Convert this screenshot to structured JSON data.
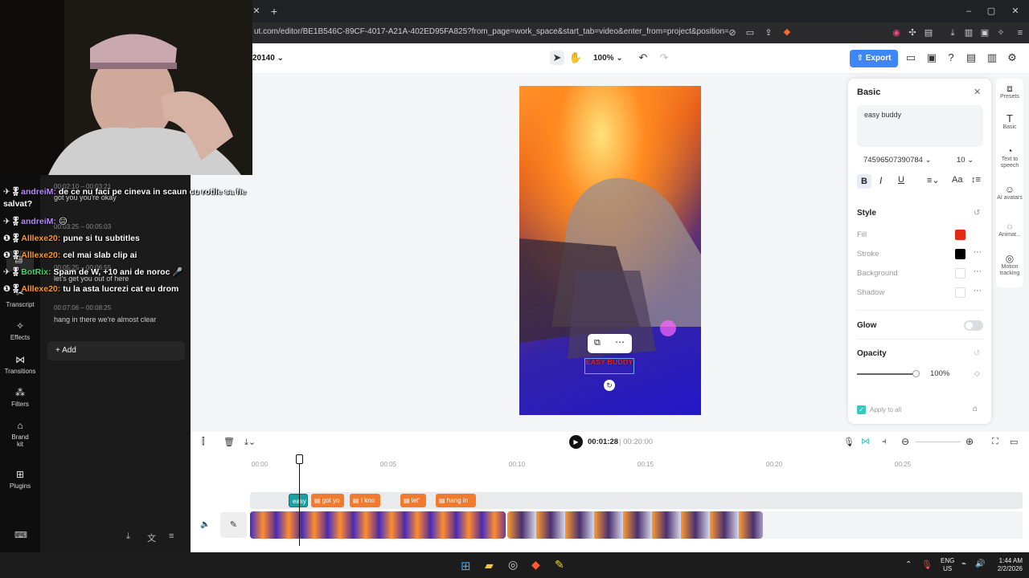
{
  "browser": {
    "url": "ut.com/editor/BE1B546C-89CF-4017-A21A-402ED95FA825?from_page=work_space&start_tab=video&enter_from=project&position=my_d..."
  },
  "header": {
    "project_name": "20140",
    "zoom": "100%",
    "export_label": "Export"
  },
  "leftnav": {
    "items": [
      {
        "label": "Transcript",
        "icon": "transcript-icon"
      },
      {
        "label": "Effects",
        "icon": "effects-icon"
      },
      {
        "label": "Transitions",
        "icon": "transitions-icon"
      },
      {
        "label": "Filters",
        "icon": "filters-icon"
      },
      {
        "label": "Brand kit",
        "icon": "brand-kit-icon"
      },
      {
        "label": "Plugins",
        "icon": "plugins-icon"
      }
    ]
  },
  "transcript": {
    "segments": [
      {
        "time": "00:02:10 – 00:03:21",
        "text": "got you you're okay"
      },
      {
        "time": "00:03:25 – 00:05:03",
        "text": ""
      },
      {
        "time": "00:05:25 – 00:06:55",
        "text": "let's get you out of here"
      },
      {
        "time": "00:07:06 – 00:08:25",
        "text": "hang in there we're almost clear"
      }
    ],
    "add_label": "Add"
  },
  "chat": [
    {
      "user": "andreiM:",
      "msg": "de ce nu faci pe cineva in scaun cu rotile sa fie",
      "cont": "salvat?"
    },
    {
      "user": "andreiM:",
      "msg": "😐"
    },
    {
      "user": "Alllexe20:",
      "msg": "pune si tu subtitles"
    },
    {
      "user": "Alllexe20:",
      "msg": "cel mai slab clip ai"
    },
    {
      "user": "BotRix:",
      "msg": "Spam de W, +10 ani de noroc 🎤"
    },
    {
      "user": "Alllexe20:",
      "msg": "tu la asta lucrezi cat eu drom"
    }
  ],
  "canvas": {
    "caption_text": "EASY BUDDY"
  },
  "props": {
    "title": "Basic",
    "text_value": "easy buddy",
    "font_name": "74596507390784",
    "font_size": "10",
    "style_title": "Style",
    "fill_label": "Fill",
    "fill_color": "#e32a12",
    "stroke_label": "Stroke",
    "stroke_color": "#000000",
    "background_label": "Background",
    "shadow_label": "Shadow",
    "glow_label": "Glow",
    "opacity_label": "Opacity",
    "opacity_value": "100%",
    "opacity_level": 1.0,
    "apply_all_label": "Apply to all"
  },
  "rightbar": {
    "items": [
      {
        "label": "Presets"
      },
      {
        "label": "Basic"
      },
      {
        "label": "Text to speech"
      },
      {
        "label": "AI avatars"
      },
      {
        "label": "Animat..."
      },
      {
        "label": "Motion tracking"
      }
    ]
  },
  "timeline": {
    "current_time": "00:01:28",
    "total_time": "00:20:00",
    "ticks": [
      "00:00",
      "00:05",
      "00:10",
      "00:15",
      "00:20",
      "00:25"
    ],
    "captions": [
      "easy",
      "got yo",
      "I kno",
      "let'",
      "hang in"
    ]
  },
  "taskbar": {
    "lang": "ENG",
    "region": "US",
    "time": "1:44 AM",
    "date": "2/2/2026"
  }
}
